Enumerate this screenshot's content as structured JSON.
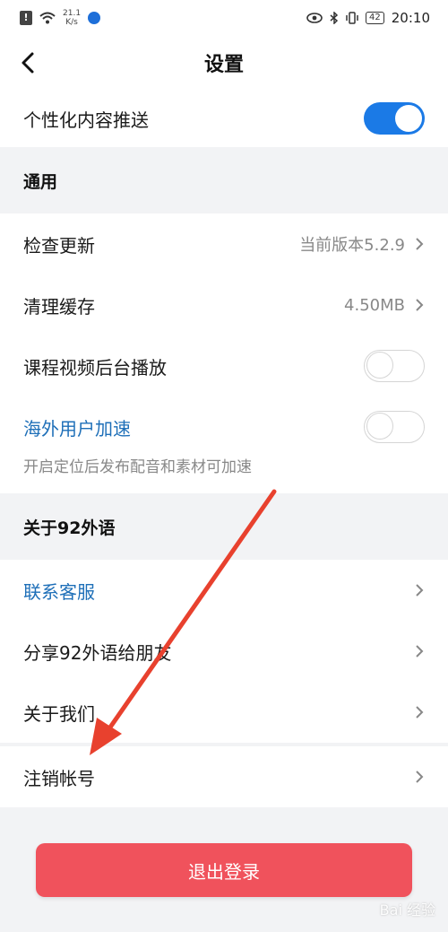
{
  "statusbar": {
    "alert": "!",
    "speed_value": "21.1",
    "speed_unit": "K/s",
    "battery": "42",
    "time": "20:10"
  },
  "nav": {
    "title": "设置"
  },
  "personalized": {
    "label": "个性化内容推送",
    "enabled": true
  },
  "general": {
    "title": "通用",
    "check_update": {
      "label": "检查更新",
      "value": "当前版本5.2.9"
    },
    "clear_cache": {
      "label": "清理缓存",
      "value": "4.50MB"
    },
    "bg_play": {
      "label": "课程视频后台播放",
      "enabled": false
    },
    "overseas": {
      "label": "海外用户加速",
      "enabled": false,
      "hint": "开启定位后发布配音和素材可加速"
    }
  },
  "about": {
    "title": "关于92外语",
    "contact": {
      "label": "联系客服"
    },
    "share": {
      "label": "分享92外语给朋友"
    },
    "about_us": {
      "label": "关于我们"
    }
  },
  "deregister": {
    "label": "注销帐号"
  },
  "logout": {
    "label": "退出登录"
  },
  "watermark": "Bai 经验",
  "colors": {
    "accent": "#1b7ae6",
    "link": "#1e6fb8",
    "logout": "#f0525c",
    "arrow": "#e8412e"
  }
}
